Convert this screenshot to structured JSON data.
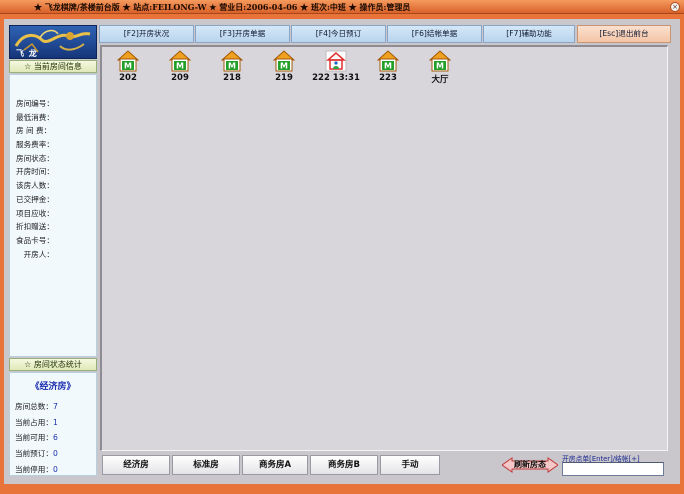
{
  "window": {
    "title": "★ 飞龙棋牌/茶楼前台版 ★ 站点:FEILONG-W ★ 营业日:2006-04-06 ★ 班次:中班 ★ 操作员:管理员",
    "close_glyph": "×"
  },
  "logo": {
    "text": "飞 龙"
  },
  "left_panel": {
    "room_info_header": "☆ 当前房间信息",
    "info_labels": [
      "房间编号：",
      "最低消费：",
      "房 间 费：",
      "服务费率：",
      "房间状态：",
      "开房时间：",
      "该房人数：",
      "已交押金：",
      "项目应收：",
      "折扣赠送：",
      "食品卡号：",
      "　开房人："
    ],
    "stats_header": "☆ 房间状态统计",
    "stats_title": "《经济房》",
    "stats": [
      {
        "label": "房间总数：",
        "value": "7"
      },
      {
        "label": "当前占用：",
        "value": "1"
      },
      {
        "label": "当前可用：",
        "value": "6"
      },
      {
        "label": "当前预订：",
        "value": "0"
      },
      {
        "label": "当前停用：",
        "value": "0"
      }
    ]
  },
  "tabs": [
    {
      "label": "[F2]开房状况"
    },
    {
      "label": "[F3]开房单据"
    },
    {
      "label": "[F4]今日预订"
    },
    {
      "label": "[F6]结帐单据"
    },
    {
      "label": "[F7]辅助功能"
    },
    {
      "label": "[Esc]退出前台"
    }
  ],
  "rooms": [
    {
      "label": "202",
      "status": "available",
      "badge": "M"
    },
    {
      "label": "209",
      "status": "available",
      "badge": "M"
    },
    {
      "label": "218",
      "status": "available",
      "badge": "M"
    },
    {
      "label": "219",
      "status": "available",
      "badge": "M"
    },
    {
      "label": "222 13:31",
      "status": "occupied",
      "badge": ""
    },
    {
      "label": "223",
      "status": "available",
      "badge": "M"
    },
    {
      "label": "大厅",
      "status": "available",
      "badge": "M"
    }
  ],
  "room_types": [
    {
      "label": "经济房"
    },
    {
      "label": "标准房"
    },
    {
      "label": "商务房A"
    },
    {
      "label": "商务房B"
    },
    {
      "label": "手动"
    }
  ],
  "refresh_button": {
    "label": "刷新房态"
  },
  "order_entry": {
    "label": "开房点单[Enter]/结帐[+]",
    "value": ""
  },
  "colors": {
    "house_roof": "#f0a020",
    "house_body": "#ffffff",
    "badge_green": "#22a02a",
    "accent_blue": "#1c2fb0",
    "frame_orange": "#e8743a"
  }
}
